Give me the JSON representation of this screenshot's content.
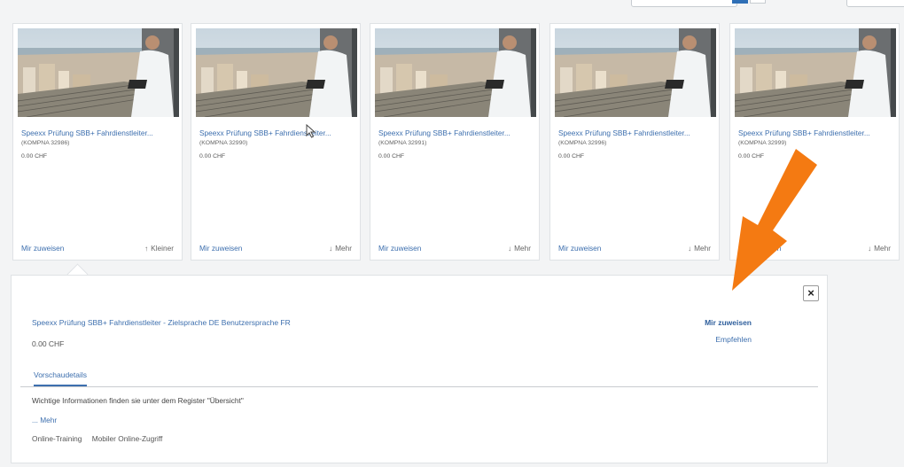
{
  "colors": {
    "link": "#3d6fae",
    "accent_arrow": "#f47a12",
    "border": "#dfe2e5"
  },
  "cards": [
    {
      "title": "Speexx Prüfung SBB+ Fahrdienstleiter...",
      "code": "(KOMPNA 32986)",
      "price": "0.00 CHF",
      "assign": "Mir zuweisen",
      "toggle_icon": "↑",
      "toggle": "Kleiner"
    },
    {
      "title": "Speexx Prüfung SBB+ Fahrdienstleiter...",
      "code": "(KOMPNA 32990)",
      "price": "0.00 CHF",
      "assign": "Mir zuweisen",
      "toggle_icon": "↓",
      "toggle": "Mehr"
    },
    {
      "title": "Speexx Prüfung SBB+ Fahrdienstleiter...",
      "code": "(KOMPNA 32991)",
      "price": "0.00 CHF",
      "assign": "Mir zuweisen",
      "toggle_icon": "↓",
      "toggle": "Mehr"
    },
    {
      "title": "Speexx Prüfung SBB+ Fahrdienstleiter...",
      "code": "(KOMPNA 32996)",
      "price": "0.00 CHF",
      "assign": "Mir zuweisen",
      "toggle_icon": "↓",
      "toggle": "Mehr"
    },
    {
      "title": "Speexx Prüfung SBB+ Fahrdienstleiter...",
      "code": "(KOMPNA 32999)",
      "price": "0.00 CHF",
      "assign": "Mir zuweisen",
      "toggle_icon": "↓",
      "toggle": "Mehr"
    }
  ],
  "detail": {
    "close": "×",
    "title": "Speexx Prüfung SBB+ Fahrdienstleiter - Zielsprache DE Benutzersprache FR",
    "price": "0.00 CHF",
    "assign": "Mir zuweisen",
    "recommend": "Empfehlen",
    "tab": "Vorschaudetails",
    "info": "Wichtige Informationen finden sie unter dem Register \"Übersicht\"",
    "more": "... Mehr",
    "tags": [
      "Online-Training",
      "Mobiler Online-Zugriff"
    ]
  }
}
